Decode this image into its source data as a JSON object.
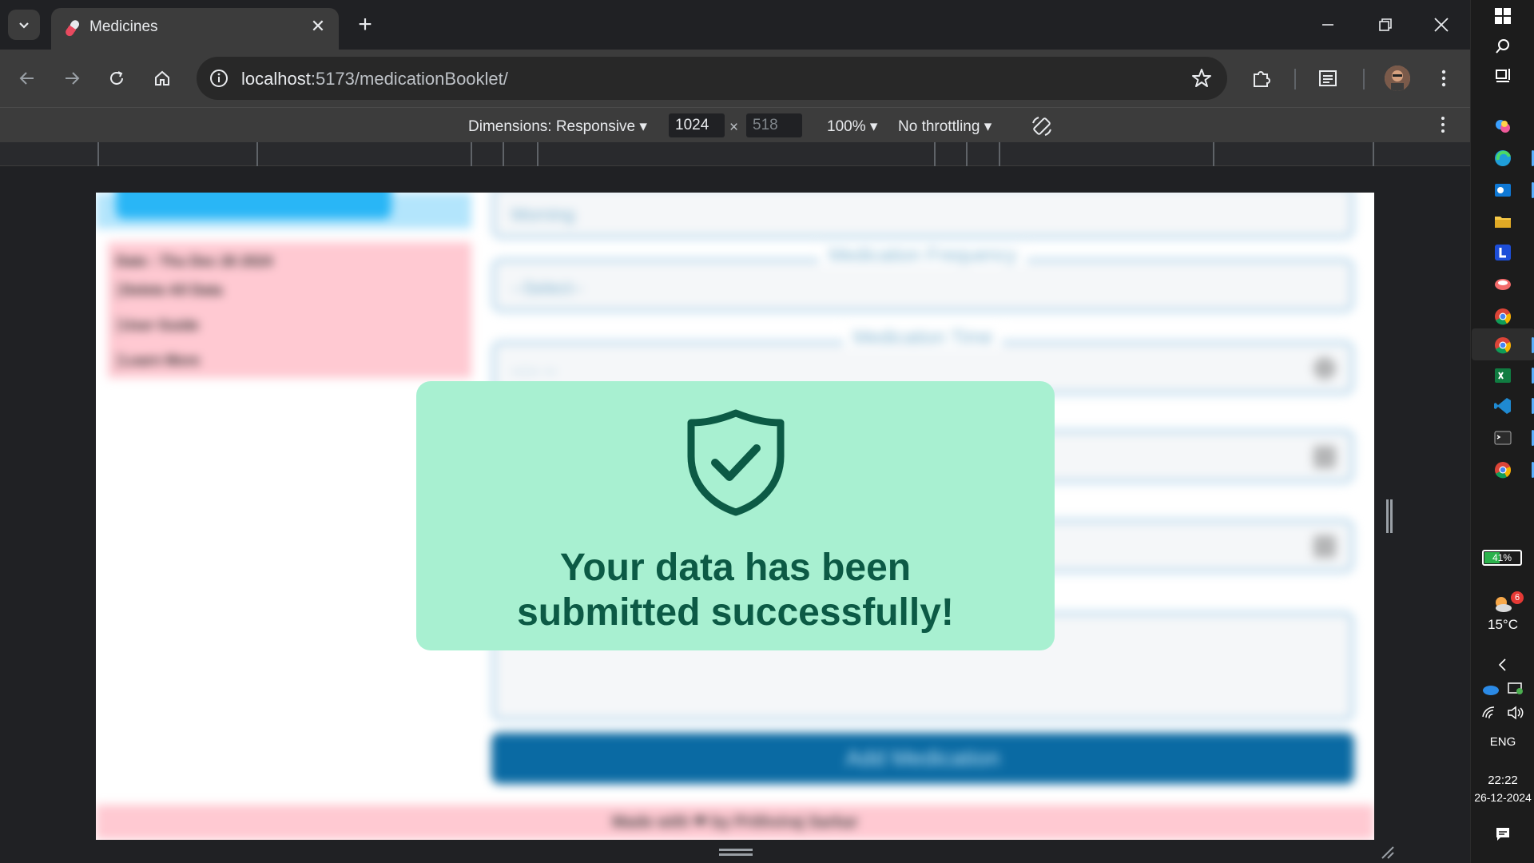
{
  "browser": {
    "tab_title": "Medicines",
    "url_host": "localhost",
    "url_path": ":5173/medicationBooklet/"
  },
  "devtools": {
    "dimensions_label": "Dimensions: Responsive",
    "width_value": "1024",
    "times": "×",
    "height_value": "518",
    "zoom": "100%",
    "throttling": "No throttling"
  },
  "page": {
    "menu_date": "Date : Thu Dec 26 2024",
    "menu_items": [
      "Delete All Data",
      "User Guide",
      "Learn More"
    ],
    "field_placeholder_1": "Morning",
    "frequency_label": "Medication Frequency",
    "frequency_placeholder": "--Select--",
    "time_label": "Medication Time",
    "time_placeholder": "--:-- --",
    "submit_label": "Add Medication",
    "footer": "Made with ❤ by Prithviraj Sarkar"
  },
  "modal": {
    "line1": "Your data has been",
    "line2": "submitted successfully!",
    "icon": "shield-check-icon",
    "accent": "#0c5a45",
    "background": "#a8f0d1"
  },
  "taskbar": {
    "battery": "41%",
    "weather_temp": "15°C",
    "weather_badge": "6",
    "language": "ENG",
    "time": "22:22",
    "date": "26-12-2024"
  }
}
